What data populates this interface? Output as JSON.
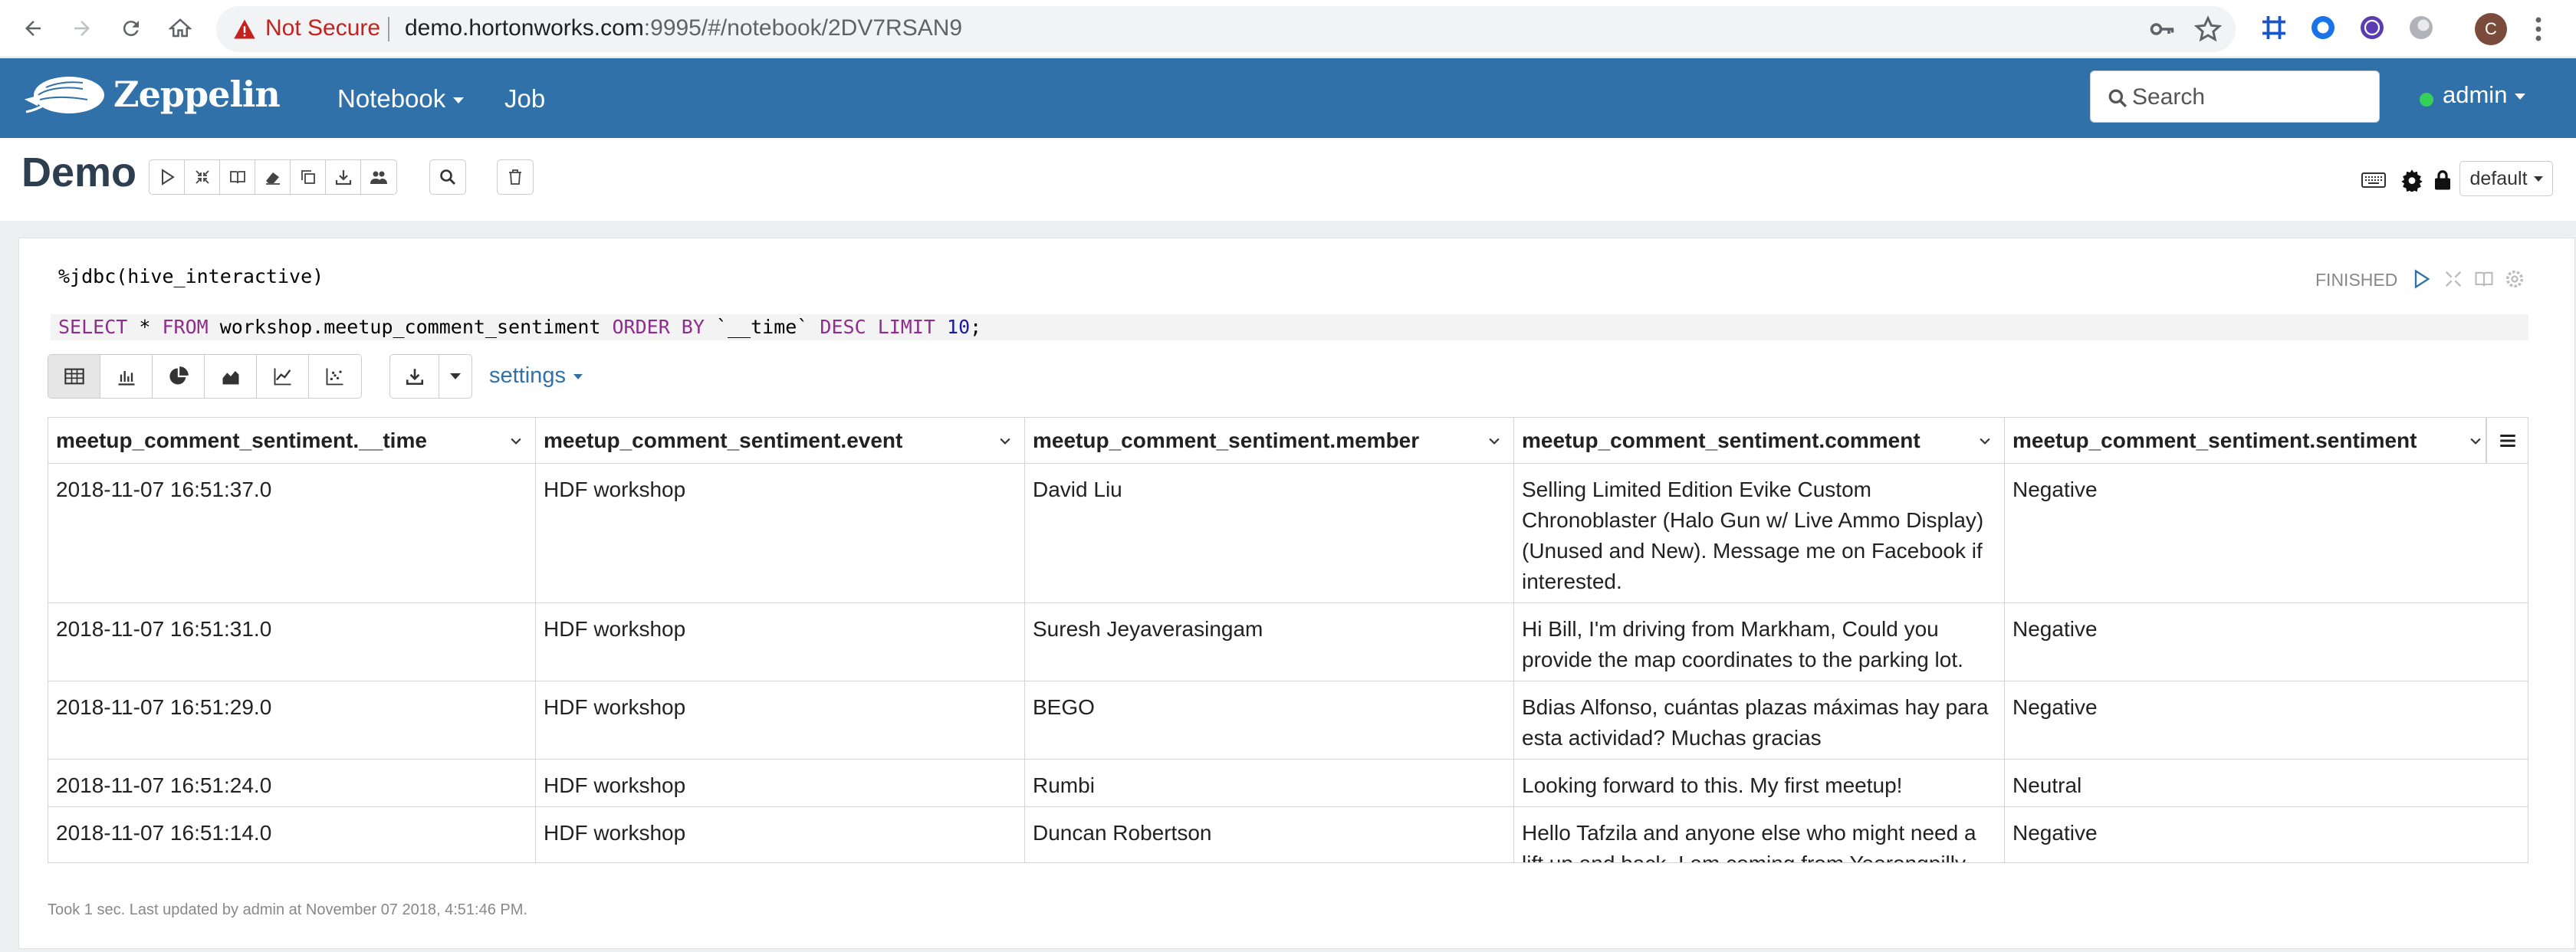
{
  "browser": {
    "not_secure": "Not Secure",
    "url_host": "demo.hortonworks.com",
    "url_rest": ":9995/#/notebook/2DV7RSAN9",
    "profile_initial": "C",
    "icons": [
      "back-icon",
      "forward-icon",
      "reload-icon",
      "home-icon",
      "warning-icon",
      "key-icon",
      "star-icon"
    ]
  },
  "navbar": {
    "brand": "Zeppelin",
    "notebook_label": "Notebook",
    "job_label": "Job",
    "search_placeholder": "Search",
    "user": "admin",
    "status_color": "#34d058",
    "bg_color": "#3071a9"
  },
  "note": {
    "title": "Demo",
    "default_label": "default"
  },
  "paragraph": {
    "interpreter": "%jdbc(hive_interactive)",
    "sql": {
      "select": "SELECT",
      "star": " * ",
      "from": "FROM",
      "table": " workshop.meetup_comment_sentiment ",
      "order": "ORDER BY",
      "col": " `__time` ",
      "desc": "DESC",
      "limit": "LIMIT",
      "sp": " ",
      "n": "10",
      "semi": ";"
    },
    "status": "FINISHED",
    "settings_label": "settings",
    "footer": "Took 1 sec. Last updated by admin at November 07 2018, 4:51:46 PM."
  },
  "table": {
    "columns": [
      "meetup_comment_sentiment.__time",
      "meetup_comment_sentiment.event",
      "meetup_comment_sentiment.member",
      "meetup_comment_sentiment.comment",
      "meetup_comment_sentiment.sentiment"
    ],
    "rows": [
      [
        "2018-11-07 16:51:37.0",
        "HDF workshop",
        "David Liu",
        "Selling Limited Edition Evike Custom Chronoblaster (Halo Gun w/ Live Ammo Display) (Unused and New). Message me on Facebook if interested.",
        "Negative"
      ],
      [
        "2018-11-07 16:51:31.0",
        "HDF workshop",
        "Suresh Jeyaverasingam",
        "Hi Bill, I'm driving from Markham, Could you provide the map coordinates to the parking lot.",
        "Negative"
      ],
      [
        "2018-11-07 16:51:29.0",
        "HDF workshop",
        "BEGO",
        "Bdias Alfonso, cuántas plazas máximas hay para esta actividad? Muchas gracias",
        "Negative"
      ],
      [
        "2018-11-07 16:51:24.0",
        "HDF workshop",
        "Rumbi",
        "Looking forward to this. My first meetup!",
        "Neutral"
      ],
      [
        "2018-11-07 16:51:14.0",
        "HDF workshop",
        "Duncan Robertson",
        "Hello Tafzila and anyone else who might need a lift up and back. I am coming from Yeerongpilly",
        "Negative"
      ]
    ]
  }
}
